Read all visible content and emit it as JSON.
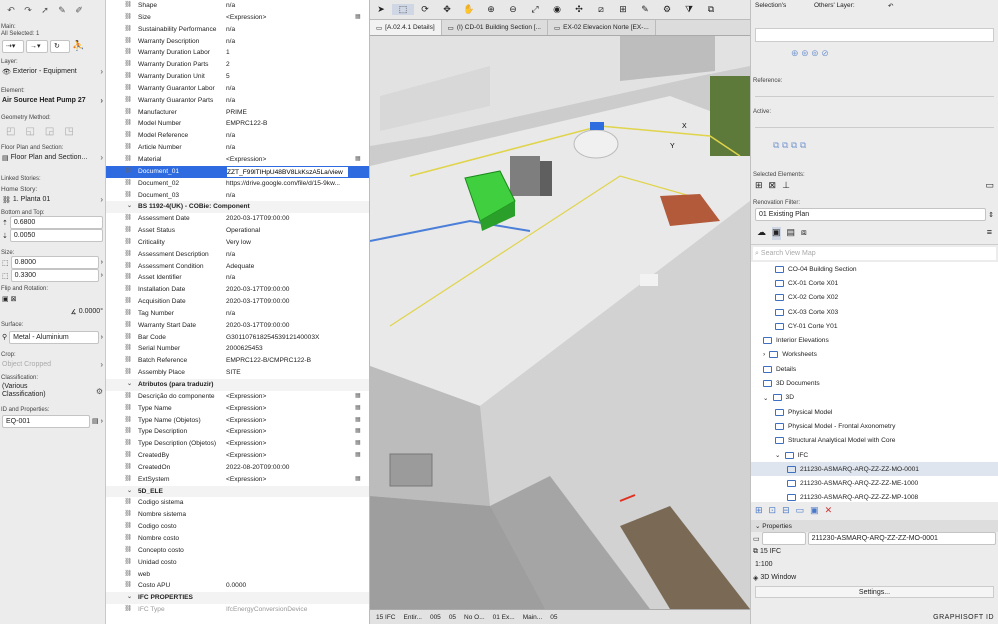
{
  "left": {
    "main_label": "Main:",
    "all_selected": "All Selected: 1",
    "layer_label": "Layer:",
    "layer_value": "Exterior - Equipment",
    "element_label": "Element:",
    "element_value": "Air Source Heat Pump 27",
    "geometry_label": "Geometry Method:",
    "floorplan_label": "Floor Plan and Section:",
    "floorplan_value": "Floor Plan and Section...",
    "linked_label": "Linked Stories:",
    "home_story_label": "Home Story:",
    "home_story_value": "1. Planta 01",
    "bottom_top_label": "Bottom and Top:",
    "top_value": "0.6800",
    "bottom_value": "0.0050",
    "size_label": "Size:",
    "size_x": "0.8000",
    "size_y": "0.3300",
    "flip_label": "Flip and Rotation:",
    "rotation": "0.0000°",
    "surface_label": "Surface:",
    "surface_value": "Metal - Aluminium",
    "crop_label": "Crop:",
    "crop_value": "Object Cropped",
    "classification_label": "Classification:",
    "classification_value": "(Various Classification)",
    "id_label": "ID and Properties:",
    "id_value": "EQ-001"
  },
  "props": [
    {
      "n": "Shape",
      "v": "n/a"
    },
    {
      "n": "Size",
      "v": "<Expression>",
      "l": "▦"
    },
    {
      "n": "Sustainability Performance",
      "v": "n/a"
    },
    {
      "n": "Warranty Description",
      "v": "n/a"
    },
    {
      "n": "Warranty Duration Labor",
      "v": "1"
    },
    {
      "n": "Warranty Duration Parts",
      "v": "2"
    },
    {
      "n": "Warranty Duration Unit",
      "v": "5"
    },
    {
      "n": "Warranty Guarantor Labor",
      "v": "n/a"
    },
    {
      "n": "Warranty Guarantor Parts",
      "v": "n/a"
    },
    {
      "n": "Manufacturer",
      "v": "PRIME"
    },
    {
      "n": "Model Number",
      "v": "EMPRC122-B"
    },
    {
      "n": "Model Reference",
      "v": "n/a"
    },
    {
      "n": "Article Number",
      "v": "n/a"
    },
    {
      "n": "Material",
      "v": "<Expression>",
      "l": "▦"
    },
    {
      "n": "Document_01",
      "v": "ZZT_F99lTIHpU48BV8LkKszA5La/view",
      "sel": true
    },
    {
      "n": "Document_02",
      "v": "https://drive.google.com/file/d/15-9kw..."
    },
    {
      "n": "Document_03",
      "v": "n/a"
    },
    {
      "g": "BS 1192-4(UK) - COBie: Component"
    },
    {
      "n": "Assessment Date",
      "v": "2020-03-17T09:00:00"
    },
    {
      "n": "Asset Status",
      "v": "Operational"
    },
    {
      "n": "Criticality",
      "v": "Very low"
    },
    {
      "n": "Assessment Description",
      "v": "n/a"
    },
    {
      "n": "Assessment Condition",
      "v": "Adequate"
    },
    {
      "n": "Asset Identifier",
      "v": "n/a"
    },
    {
      "n": "Installation Date",
      "v": "2020-03-17T09:00:00"
    },
    {
      "n": "Acquisition Date",
      "v": "2020-03-17T09:00:00"
    },
    {
      "n": "Tag Number",
      "v": "n/a"
    },
    {
      "n": "Warranty Start Date",
      "v": "2020-03-17T09:00:00"
    },
    {
      "n": "Bar Code",
      "v": "G30110761825453912140003X"
    },
    {
      "n": "Serial Number",
      "v": "2000625453"
    },
    {
      "n": "Batch Reference",
      "v": "EMPRC122-B/CMPRC122-B"
    },
    {
      "n": "Assembly Place",
      "v": "SITE"
    },
    {
      "g": "Atributos (para traduzir)"
    },
    {
      "n": "Descrição do componente",
      "v": "<Expression>",
      "l": "▦"
    },
    {
      "n": "Type Name",
      "v": "<Expression>",
      "l": "▦"
    },
    {
      "n": "Type Name (Objetos)",
      "v": "<Expression>",
      "l": "▦"
    },
    {
      "n": "Type Description",
      "v": "<Expression>",
      "l": "▦"
    },
    {
      "n": "Type Description (Objetos)",
      "v": "<Expression>",
      "l": "▦"
    },
    {
      "n": "CreatedBy",
      "v": "<Expression>",
      "l": "▦"
    },
    {
      "n": "CreatedOn",
      "v": "2022-08-20T09:00:00"
    },
    {
      "n": "ExtSystem",
      "v": "<Expression>",
      "l": "▦"
    },
    {
      "g": "5D_ELE"
    },
    {
      "n": "Codigo sistema",
      "v": ""
    },
    {
      "n": "Nombre sistema",
      "v": ""
    },
    {
      "n": "Codigo costo",
      "v": ""
    },
    {
      "n": "Nombre costo",
      "v": ""
    },
    {
      "n": "Concepto costo",
      "v": ""
    },
    {
      "n": "Unidad costo",
      "v": ""
    },
    {
      "n": "web",
      "v": ""
    },
    {
      "n": "Costo APU",
      "v": "0.0000"
    },
    {
      "g": "IFC PROPERTIES"
    },
    {
      "n": "IFC Type",
      "v": "IfcEnergyConversionDevice",
      "dim": true
    }
  ],
  "view": {
    "tabs": [
      "[A.02.4.1 Details]",
      "(I) CD-01 Building Section [...",
      "EX-02 Elevacion Norte [EX-..."
    ],
    "status": [
      "15 IFC",
      "Entir...",
      "005",
      "05",
      "No O...",
      "01 Ex...",
      "Main...",
      "05"
    ],
    "axis_y": "Y",
    "axis_x": "X"
  },
  "nav": {
    "selections_label": "Selection's",
    "others_layer_label": "Others' Layer:",
    "reference_label": "Reference:",
    "active_label": "Active:",
    "selected_elements_label": "Selected Elements:",
    "renovation_label": "Renovation Filter:",
    "renovation_value": "01 Existing Plan",
    "search_placeholder": "Search View Map",
    "items": [
      {
        "t": "CO-04 Building Section",
        "d": 2
      },
      {
        "t": "CX-01 Corte X01",
        "d": 2
      },
      {
        "t": "CX-02 Corte X02",
        "d": 2
      },
      {
        "t": "CX-03 Corte X03",
        "d": 2
      },
      {
        "t": "CY-01 Corte Y01",
        "d": 2
      },
      {
        "t": "Interior Elevations",
        "d": 1
      },
      {
        "t": "Worksheets",
        "d": 1,
        "e": "›"
      },
      {
        "t": "Details",
        "d": 1
      },
      {
        "t": "3D Documents",
        "d": 1
      },
      {
        "t": "3D",
        "d": 1,
        "e": "⌄"
      },
      {
        "t": "Physical Model",
        "d": 2
      },
      {
        "t": "Physical Model - Frontal Axonometry",
        "d": 2
      },
      {
        "t": "Structural Analytical Model with Core",
        "d": 2
      },
      {
        "t": "IFC",
        "d": 2,
        "e": "⌄"
      },
      {
        "t": "211230-ASMARQ-ARQ-ZZ-ZZ-MO-0001",
        "d": 3,
        "sel": true
      },
      {
        "t": "211230-ASMARQ-ARQ-ZZ-ZZ-ME-1000",
        "d": 3
      },
      {
        "t": "211230-ASMARQ-ARQ-ZZ-ZZ-MP-1008",
        "d": 3
      }
    ],
    "properties_label": "Properties",
    "prop_name": "211230-ASMARQ-ARQ-ZZ-ZZ-MO-0001",
    "prop_layer": "15 IFC",
    "prop_scale": "1:100",
    "prop_window": "3D Window",
    "settings_label": "Settings...",
    "brand": "GRAPHISOFT ID"
  }
}
